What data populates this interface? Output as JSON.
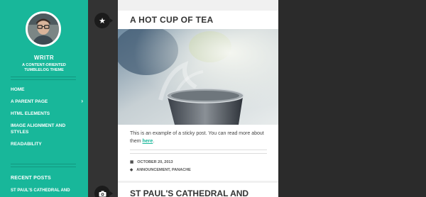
{
  "sidebar": {
    "title": "WRITR",
    "tagline": "A CONTENT-ORIENTED TUMBLELOG THEME",
    "nav": [
      {
        "label": "HOME"
      },
      {
        "label": "A PARENT PAGE",
        "chevron": "›"
      },
      {
        "label": "HTML ELEMENTS"
      },
      {
        "label": "IMAGE ALIGNMENT AND STYLES"
      },
      {
        "label": "READABILITY"
      }
    ],
    "recent_heading": "RECENT POSTS",
    "recent_item": "ST PAUL'S CATHEDRAL AND"
  },
  "posts": [
    {
      "format_icon": "★",
      "format_icon_name": "star-icon",
      "title": "A HOT CUP OF TEA",
      "excerpt_text": "This is an example of a sticky post. You can read more about them ",
      "excerpt_link": "here",
      "excerpt_end": ".",
      "date": "OCTOBER 20, 2013",
      "date_icon": "▦",
      "categories": "ANNOUNCEMENT, PANACHE",
      "tag_icon": "◆"
    },
    {
      "format_icon": "📷",
      "format_icon_name": "camera-icon",
      "title": "ST PAUL'S CATHEDRAL AND"
    }
  ],
  "colors": {
    "accent": "#18b79a",
    "sidebar_bg": "#18b79a",
    "dark_bg": "#2b2b2b",
    "icon_bg": "#1b1b1b"
  }
}
